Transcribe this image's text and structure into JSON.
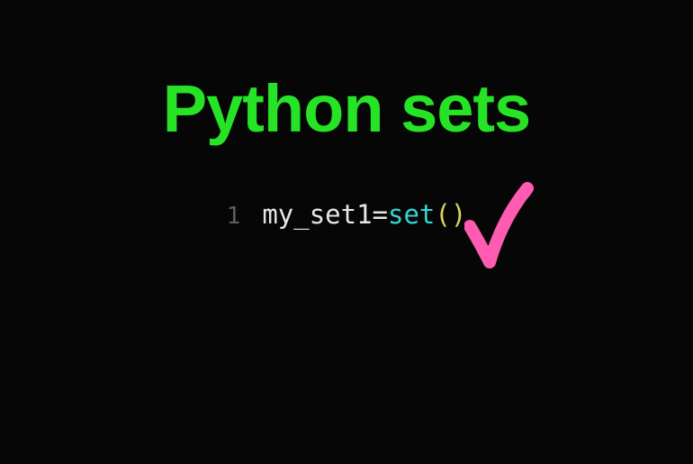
{
  "title": "Python sets",
  "code": {
    "line_number": "1",
    "variable": "my_set1 ",
    "operator": "= ",
    "func": "set",
    "paren_open": "(",
    "paren_close": ")"
  }
}
